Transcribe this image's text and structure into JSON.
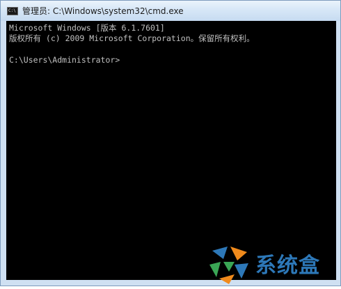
{
  "window": {
    "title": "管理员: C:\\Windows\\system32\\cmd.exe",
    "icon": "cmd-icon",
    "icon_text": "C:\\"
  },
  "console": {
    "lines": [
      "Microsoft Windows [版本 6.1.7601]",
      "版权所有 (c) 2009 Microsoft Corporation。保留所有权利。",
      "",
      "C:\\Users\\Administrator>"
    ]
  },
  "watermark": {
    "text": "系统盒",
    "colors": {
      "blue": "#2d78b8",
      "orange": "#f08a1c",
      "green": "#3aa655"
    }
  },
  "colors": {
    "console_bg": "#000000",
    "console_text": "#c0c0c0",
    "frame": "#cfe0f2"
  }
}
